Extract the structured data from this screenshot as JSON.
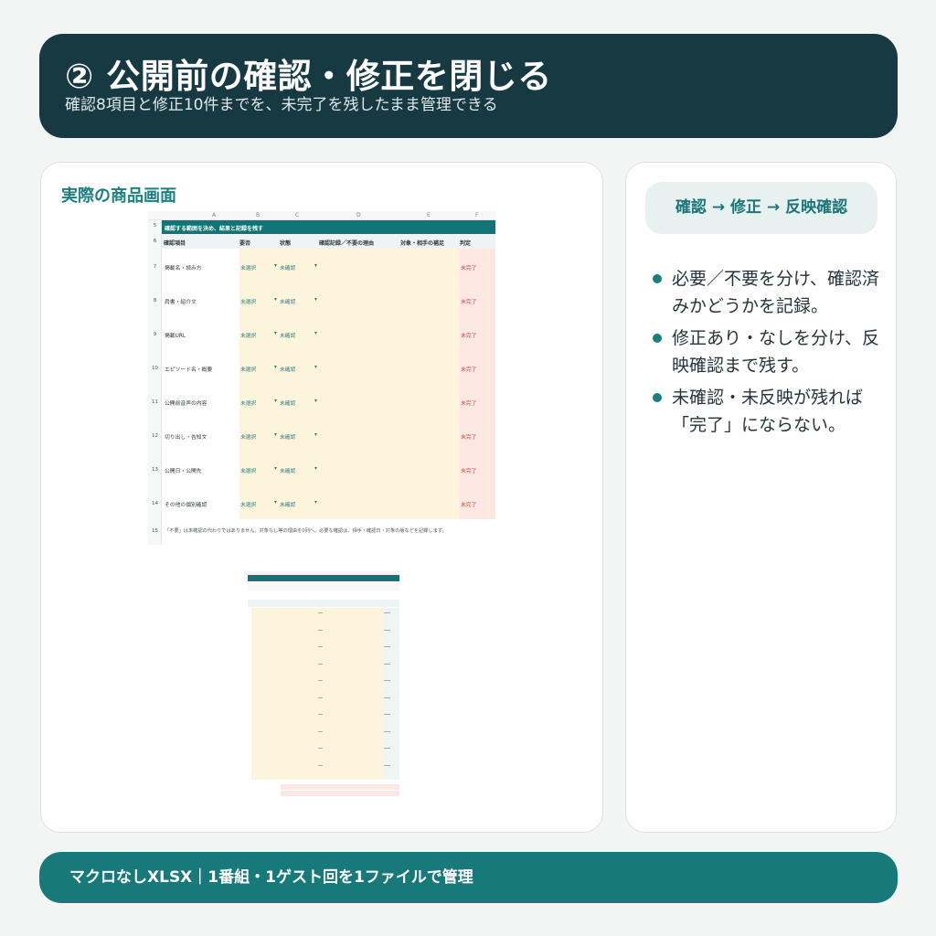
{
  "header": {
    "title": "② 公開前の確認・修正を閉じる",
    "subtitle": "確認8項目と修正10件までを、未完了を残したまま管理できる"
  },
  "left_card": {
    "title": "実際の商品画面",
    "sheet1": {
      "columns": [
        "A",
        "B",
        "C",
        "D",
        "E",
        "F"
      ],
      "banner_row": "5",
      "banner": "確認する範囲を決め、結果と記録を残す",
      "header_row": "6",
      "headers": [
        "確認項目",
        "要否",
        "状態",
        "確認記録／不要の理由",
        "対象・相手の補足",
        "判定"
      ],
      "rows": [
        {
          "num": "7",
          "item": "掲載名・読み方",
          "need": "未選択",
          "state": "未確認",
          "verdict": "未完了"
        },
        {
          "num": "8",
          "item": "肩書・紹介文",
          "need": "未選択",
          "state": "未確認",
          "verdict": "未完了"
        },
        {
          "num": "9",
          "item": "掲載URL",
          "need": "未選択",
          "state": "未確認",
          "verdict": "未完了"
        },
        {
          "num": "10",
          "item": "エピソード名・概要",
          "need": "未選択",
          "state": "未確認",
          "verdict": "未完了"
        },
        {
          "num": "11",
          "item": "公開前音声の内容",
          "need": "未選択",
          "state": "未確認",
          "verdict": "未完了"
        },
        {
          "num": "12",
          "item": "切り出し・告知文",
          "need": "未選択",
          "state": "未確認",
          "verdict": "未完了"
        },
        {
          "num": "13",
          "item": "公開日・公開先",
          "need": "未選択",
          "state": "未確認",
          "verdict": "未完了"
        },
        {
          "num": "14",
          "item": "その他の個別確認",
          "need": "未選択",
          "state": "未確認",
          "verdict": "未完了"
        }
      ],
      "dropdown_glyph": "▾",
      "note_row": "15",
      "note": "「不要」は未確認の代わりではありません。対象なし等の理由を0列へ。必要な確認は、相手・確認日・対象の版などを記録します。"
    }
  },
  "right_card": {
    "flow": "確認 → 修正 → 反映確認",
    "bullets": [
      "必要／不要を分け、確認済みかどうかを記録。",
      "修正あり・なしを分け、反映確認まで残す。",
      "未確認・未反映が残れば「完了」にならない。"
    ]
  },
  "footer": {
    "text": "マクロなしXLSX｜1番組・1ゲスト回を1ファイルで管理"
  },
  "colors": {
    "header_bg": "#173a42",
    "accent": "#1a7f80",
    "footer_bg": "#18797b",
    "sheet_banner": "#127474",
    "input_yellow": "#fdf4dc",
    "status_pink": "#fde8e4",
    "status_red": "#c8463a"
  }
}
